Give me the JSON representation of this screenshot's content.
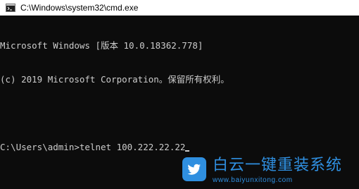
{
  "window": {
    "title": "C:\\Windows\\system32\\cmd.exe",
    "icon": "cmd-icon"
  },
  "console": {
    "lines": [
      "Microsoft Windows [版本 10.0.18362.778]",
      "(c) 2019 Microsoft Corporation。保留所有权利。",
      "",
      "C:\\Users\\admin>telnet 100.222.22.22"
    ],
    "colors": {
      "background": "#0c0c0c",
      "text": "#cccccc"
    }
  },
  "watermark": {
    "title": "白云一键重装系统",
    "url": "www.baiyunxitong.com",
    "icon": "twitter-bird-logo-icon",
    "color": "#2f8fe0"
  }
}
